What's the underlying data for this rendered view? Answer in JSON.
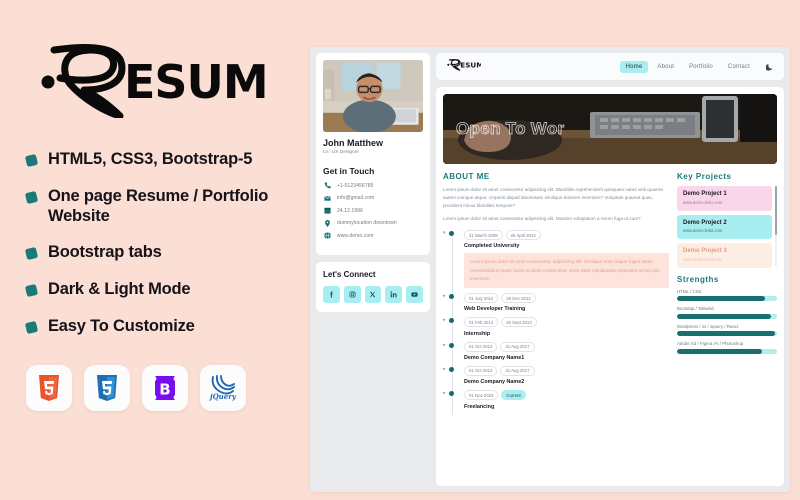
{
  "promo": {
    "logo_text": "RESUME.",
    "features": [
      "HTML5, CSS3, Bootstrap-5",
      "One page Resume / Portfolio Website",
      "Bootstrap tabs",
      "Dark & Light Mode",
      "Easy To Customize"
    ],
    "tech_badges": [
      {
        "name": "html5-badge",
        "label": "5"
      },
      {
        "name": "css3-badge",
        "label": "3"
      },
      {
        "name": "bootstrap-badge",
        "label": "B"
      },
      {
        "name": "jquery-badge",
        "label": "jQuery"
      }
    ],
    "colors": {
      "background": "#fbded4",
      "bullet": "#1b7a78",
      "text": "#15131a"
    }
  },
  "preview": {
    "profile": {
      "name": "John Matthew",
      "role": "UI / UX Designer",
      "get_in_touch_heading": "Get in Touch",
      "contacts": [
        {
          "icon": "phone-icon",
          "value": "+1-0123456789"
        },
        {
          "icon": "mail-icon",
          "value": "info@gmail.com"
        },
        {
          "icon": "calendar-icon",
          "value": "24.12.1996"
        },
        {
          "icon": "location-icon",
          "value": "dummylocation downtown"
        },
        {
          "icon": "globe-icon",
          "value": "www.demo.com"
        }
      ],
      "connect_heading": "Let's Connect",
      "socials": [
        {
          "icon": "facebook-icon",
          "label": "f"
        },
        {
          "icon": "instagram-icon",
          "label": "ig"
        },
        {
          "icon": "x-twitter-icon",
          "label": "X"
        },
        {
          "icon": "linkedin-icon",
          "label": "in"
        },
        {
          "icon": "youtube-icon",
          "label": "yt"
        }
      ]
    },
    "navbar": {
      "logo_text": "RESUME.",
      "links": [
        {
          "label": "Home",
          "active": true
        },
        {
          "label": "About",
          "active": false
        },
        {
          "label": "Portfolio",
          "active": false
        },
        {
          "label": "Contact",
          "active": false
        }
      ],
      "theme_toggle_icon": "moon-icon",
      "active_color": "#a8eef0"
    },
    "hero": {
      "headline": "Open To Wor"
    },
    "about": {
      "title": "ABOUT ME",
      "paragraphs": [
        "Lorem ipsum dolor sit amet consectetur adipisicing elit. Blanditiis reprehenderit quisquam natus velit quaerat autem cumque atque, corporis aliquid laboriosam similique dolorem inventore? Voluptate quaerat quas, provident minus blanditiis tempore?",
        "Lorem ipsum dolor sit amet consectetur adipisicing elit. Maxime voluptatum a rerum fuga ut cum?"
      ]
    },
    "timeline": [
      {
        "expanded": true,
        "from": "31 March 2009",
        "to": "25 April 2012",
        "title": "Completed University",
        "description": "Lorem ipsum dolor sit amet consectetur, adipisicing elit. Similique enim itaque fugiat natus necessitatibus quam facilis incidunt consectetur. Esse vitae repudiandae provident minus quo inventore."
      },
      {
        "expanded": false,
        "from": "01 July 2012",
        "to": "25 Dec 2012",
        "title": "Web Developer Training",
        "description": ""
      },
      {
        "expanded": false,
        "from": "01 Feb 2013",
        "to": "26 Sept 2013",
        "title": "Internship",
        "description": ""
      },
      {
        "expanded": false,
        "from": "01 Oct 2013",
        "to": "31 Aug 2017",
        "title": "Demo Company Name1",
        "description": ""
      },
      {
        "expanded": false,
        "from": "01 Oct 2013",
        "to": "31 Aug 2017",
        "title": "Demo Company Name2",
        "description": ""
      },
      {
        "expanded": false,
        "from": "01 Nov 2023",
        "to": "Current",
        "to_is_current": true,
        "title": "Freelancing",
        "description": ""
      }
    ],
    "key_projects": {
      "title": "Key Projects",
      "items": [
        {
          "name": "Demo Project 1",
          "link": "www.demo.link1.com",
          "bg": "#f9d6ea",
          "name_color": "#1c1a24",
          "link_color": "#8c8594"
        },
        {
          "name": "Demo Project 2",
          "link": "www.demo.link2.com",
          "bg": "#a8eef0",
          "name_color": "#1c1a24",
          "link_color": "#54737a"
        },
        {
          "name": "Demo Project 3",
          "link": "www.demo.link3.com",
          "bg": "#fdeee4",
          "name_color": "#e89b84",
          "link_color": "#eec0ab"
        }
      ]
    },
    "strengths": {
      "title": "Strengths",
      "items": [
        {
          "label": "HTML / CSS",
          "percent": 88
        },
        {
          "label": "Bootstap / Tailwind",
          "percent": 94
        },
        {
          "label": "Wordpress / Js / Jquery / React",
          "percent": 98
        },
        {
          "label": "Adobe Xd / Figma /Ai / Photoshop",
          "percent": 85
        }
      ],
      "bar_fill_color": "#17706f",
      "bar_track_color": "#b6ecee"
    }
  }
}
